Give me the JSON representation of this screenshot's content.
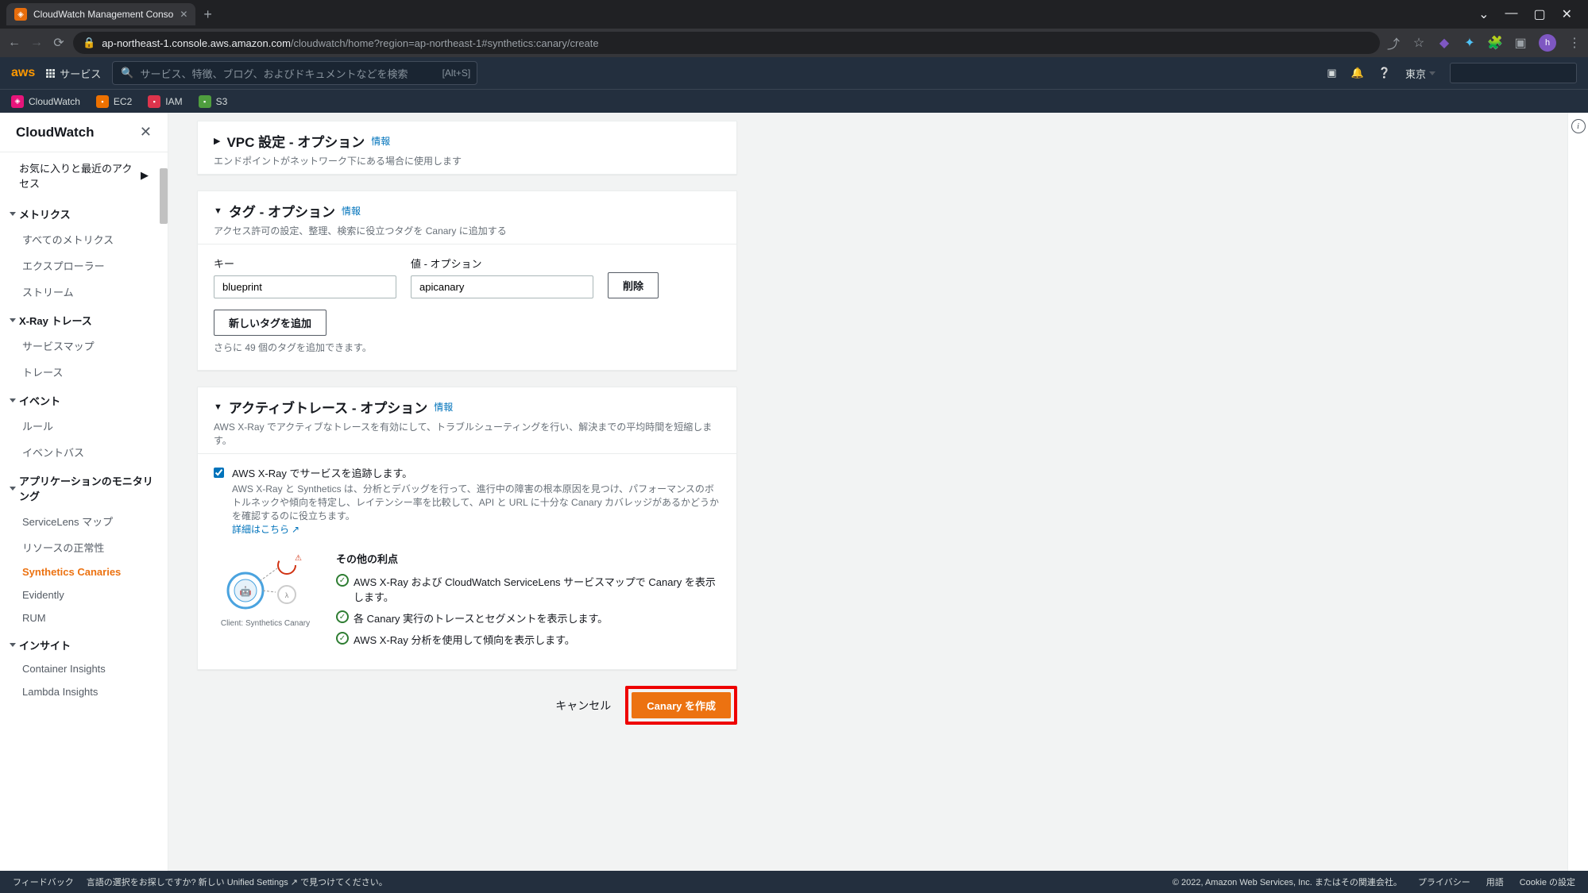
{
  "browser": {
    "tab_title": "CloudWatch Management Conso",
    "url_host": "ap-northeast-1.console.aws.amazon.com",
    "url_path": "/cloudwatch/home?region=ap-northeast-1#synthetics:canary/create",
    "avatar_initial": "h"
  },
  "aws_nav": {
    "services": "サービス",
    "search_placeholder": "サービス、特徴、ブログ、およびドキュメントなどを検索",
    "search_shortcut": "[Alt+S]",
    "region": "東京"
  },
  "svc_bar": {
    "cloudwatch": "CloudWatch",
    "ec2": "EC2",
    "iam": "IAM",
    "s3": "S3"
  },
  "sidebar": {
    "title": "CloudWatch",
    "favorites": "お気に入りと最近のアクセス",
    "groups": {
      "metrics": {
        "label": "メトリクス",
        "items": [
          "すべてのメトリクス",
          "エクスプローラー",
          "ストリーム"
        ]
      },
      "xray": {
        "label": "X-Ray トレース",
        "items": [
          "サービスマップ",
          "トレース"
        ]
      },
      "events": {
        "label": "イベント",
        "items": [
          "ルール",
          "イベントバス"
        ]
      },
      "appmon": {
        "label": "アプリケーションのモニタリング",
        "items": [
          "ServiceLens マップ",
          "リソースの正常性",
          "Synthetics Canaries",
          "Evidently",
          "RUM"
        ]
      },
      "insights": {
        "label": "インサイト",
        "items": [
          "Container Insights",
          "Lambda Insights"
        ]
      }
    }
  },
  "panels": {
    "vpc": {
      "title": "VPC 設定 - オプション",
      "info": "情報",
      "desc": "エンドポイントがネットワーク下にある場合に使用します"
    },
    "tags": {
      "title": "タグ - オプション",
      "info": "情報",
      "desc": "アクセス許可の設定、整理、検索に役立つタグを Canary に追加する",
      "key_label": "キー",
      "value_label": "値 - オプション",
      "key_value": "blueprint",
      "value_value": "apicanary",
      "delete_btn": "削除",
      "add_btn": "新しいタグを追加",
      "hint": "さらに 49 個のタグを追加できます。"
    },
    "trace": {
      "title": "アクティブトレース - オプション",
      "info": "情報",
      "desc": "AWS X-Ray でアクティブなトレースを有効にして、トラブルシューティングを行い、解決までの平均時間を短縮します。",
      "chk_label": "AWS X-Ray でサービスを追跡します。",
      "chk_desc": "AWS X-Ray と Synthetics は、分析とデバッグを行って、進行中の障害の根本原因を見つけ、パフォーマンスのボトルネックや傾向を特定し、レイテンシー率を比較して、API と URL に十分な Canary カバレッジがあるかどうかを確認するのに役立ちます。",
      "learn_more": "詳細はこちら",
      "illus_caption": "Client: Synthetics Canary",
      "benefits_title": "その他の利点",
      "benefits": [
        "AWS X-Ray および CloudWatch ServiceLens サービスマップで Canary を表示します。",
        "各 Canary 実行のトレースとセグメントを表示します。",
        "AWS X-Ray 分析を使用して傾向を表示します。"
      ]
    }
  },
  "actions": {
    "cancel": "キャンセル",
    "create": "Canary を作成"
  },
  "footer": {
    "feedback": "フィードバック",
    "lang_prompt": "言語の選択をお探しですか? 新しい",
    "unified": "Unified Settings",
    "lang_suffix": "で見つけてください。",
    "copyright": "© 2022, Amazon Web Services, Inc. またはその関連会社。",
    "privacy": "プライバシー",
    "terms": "用語",
    "cookie": "Cookie の設定"
  }
}
